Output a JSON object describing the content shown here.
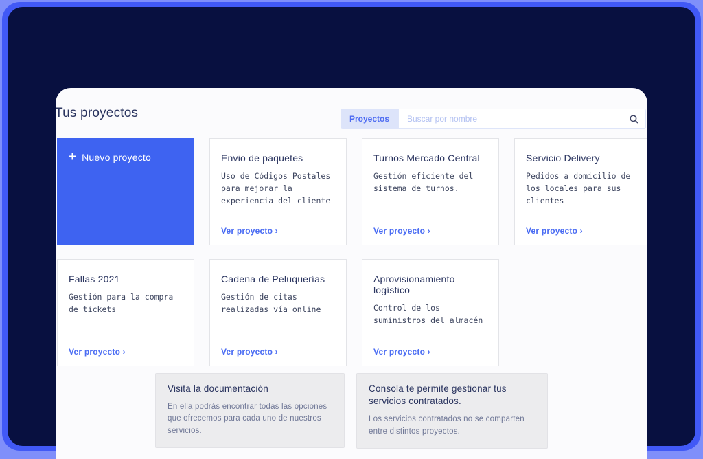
{
  "page": {
    "title": "Tus proyectos"
  },
  "search": {
    "tab_label": "Proyectos",
    "placeholder": "Buscar por nombre"
  },
  "new_project": {
    "label": "Nuevo proyecto",
    "plus_glyph": "+"
  },
  "projects": [
    {
      "title": "Envio de paquetes",
      "description": "Uso de Códigos Postales para mejorar la experiencia del cliente",
      "link": "Ver proyecto ›"
    },
    {
      "title": "Turnos Mercado Central",
      "description": "Gestión eficiente del sistema de turnos.",
      "link": "Ver proyecto ›"
    },
    {
      "title": "Servicio Delivery",
      "description": "Pedidos a domicilio de los locales para sus clientes",
      "link": "Ver proyecto ›"
    },
    {
      "title": "Fallas 2021",
      "description": "Gestión para la compra de tickets",
      "link": "Ver proyecto ›"
    },
    {
      "title": "Cadena de Peluquerías",
      "description": "Gestión de citas realizadas vía online",
      "link": "Ver proyecto ›"
    },
    {
      "title": "Aprovisionamiento logístico",
      "description": "Control de los suministros del almacén",
      "link": "Ver proyecto ›"
    }
  ],
  "info_boxes": [
    {
      "title": "Visita la documentación",
      "description": "En ella podrás encontrar todas las opciones que ofrecemos para cada uno de nuestros servicios."
    },
    {
      "title": "Consola te permite gestionar tus servicios contratados.",
      "description": "Los servicios contratados no se comparten entre distintos proyectos."
    }
  ],
  "colors": {
    "frame_outer": "#7f8ffa",
    "frame_stripe": "#4159f6",
    "frame_navy": "#081040",
    "panel_bg": "#fbfbfd",
    "accent_blue": "#3e63f1",
    "link_blue": "#4a6cf3",
    "tab_bg": "#dde4fa",
    "title_navy": "#2b3560"
  }
}
